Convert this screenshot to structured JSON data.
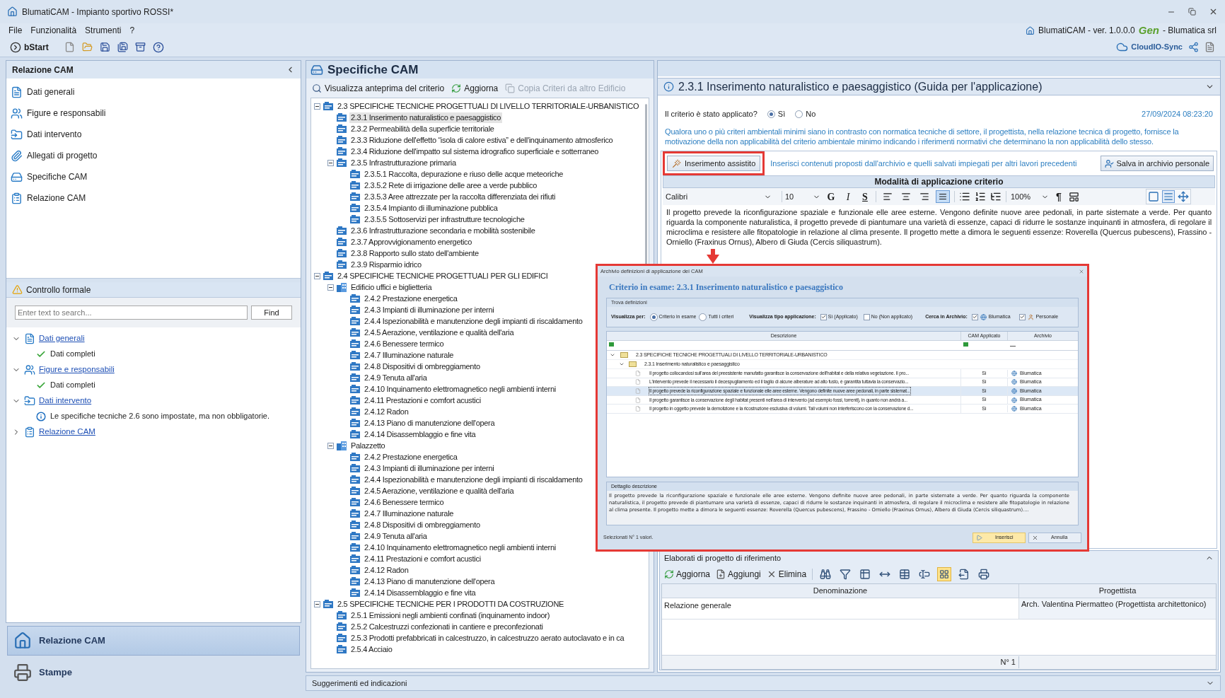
{
  "window": {
    "title": "BlumatiCAM - Impianto sportivo ROSSI*"
  },
  "menu": [
    "File",
    "Funzionalità",
    "Strumenti",
    "?"
  ],
  "product": {
    "version": "BlumatiCAM - ver. 1.0.0.0",
    "logo": "Gen",
    "company": "- Blumatica srl"
  },
  "toolbar": {
    "start": "bStart",
    "sync": "CloudIO-Sync"
  },
  "nav_panel": {
    "title": "Relazione CAM",
    "items": [
      "Dati generali",
      "Figure e responsabili",
      "Dati intervento",
      "Allegati di progetto",
      "Specifiche CAM",
      "Relazione CAM"
    ]
  },
  "formal_check": {
    "title": "Controllo formale",
    "search": {
      "placeholder": "Enter text to search..."
    },
    "find_button": "Find",
    "items": [
      {
        "label": "Dati generali",
        "expanded": true,
        "children": [
          {
            "label": "Dati completi",
            "kind": "ok"
          }
        ]
      },
      {
        "label": "Figure e responsabili",
        "expanded": true,
        "children": [
          {
            "label": "Dati completi",
            "kind": "ok"
          }
        ]
      },
      {
        "label": "Dati intervento",
        "expanded": true,
        "children": [
          {
            "label": "Le specifiche tecniche 2.6 sono impostate, ma non obbligatorie.",
            "kind": "info"
          }
        ]
      },
      {
        "label": "Relazione CAM",
        "expanded": false
      }
    ]
  },
  "nav_buttons": [
    {
      "label": "Relazione CAM",
      "selected": true
    },
    {
      "label": "Stampe",
      "selected": false
    }
  ],
  "specs_panel": {
    "title": "Specifiche CAM",
    "actions": [
      {
        "label": "Visualizza anteprima del criterio",
        "disabled": false
      },
      {
        "label": "Aggiorna",
        "disabled": false
      },
      {
        "label": "Copia Criteri da altro Edificio",
        "disabled": true
      }
    ],
    "tree": [
      {
        "label": "2.3 SPECIFICHE TECNICHE PROGETTUALI DI LIVELLO TERRITORIALE-URBANISTICO",
        "expanded": true,
        "selected": false,
        "children": [
          {
            "label": "2.3.1 Inserimento naturalistico e paesaggistico",
            "selected": true
          },
          {
            "label": "2.3.2 Permeabilità della superficie territoriale",
            "selected": false
          },
          {
            "label": "2.3.3 Riduzione dell'effetto “isola di calore estiva” e dell'inquinamento atmosferico",
            "selected": false
          },
          {
            "label": "2.3.4 Riduzione dell'impatto sul sistema idrografico superficiale e sotterraneo",
            "selected": false
          },
          {
            "label": "2.3.5 Infrastrutturazione primaria",
            "expanded": true,
            "selected": false,
            "children": [
              {
                "label": "2.3.5.1 Raccolta, depurazione e riuso delle acque meteoriche",
                "selected": false
              },
              {
                "label": "2.3.5.2 Rete di irrigazione delle aree a verde pubblico",
                "selected": false
              },
              {
                "label": "2.3.5.3 Aree attrezzate per la raccolta differenziata dei rifiuti",
                "selected": false
              },
              {
                "label": "2.3.5.4 Impianto di illuminazione pubblica",
                "selected": false
              },
              {
                "label": "2.3.5.5 Sottoservizi per infrastrutture tecnologiche",
                "selected": false
              }
            ]
          },
          {
            "label": "2.3.6 Infrastrutturazione secondaria e mobilità sostenibile",
            "selected": false
          },
          {
            "label": "2.3.7 Approvvigionamento energetico",
            "selected": false
          },
          {
            "label": "2.3.8 Rapporto sullo stato dell'ambiente",
            "selected": false
          },
          {
            "label": "2.3.9 Risparmio idrico",
            "selected": false
          }
        ]
      },
      {
        "label": "2.4 SPECIFICHE TECNICHE PROGETTUALI PER GLI EDIFICI",
        "expanded": true,
        "selected": false,
        "children": [
          {
            "label": "Edificio uffici e biglietteria",
            "kind": "building",
            "expanded": true,
            "selected": false,
            "children": [
              {
                "label": "2.4.2 Prestazione energetica",
                "selected": false
              },
              {
                "label": "2.4.3 Impianti di illuminazione per interni",
                "selected": false
              },
              {
                "label": "2.4.4 Ispezionabilità e manutenzione degli impianti di riscaldamento",
                "selected": false
              },
              {
                "label": "2.4.5 Aerazione, ventilazione e qualità dell'aria",
                "selected": false
              },
              {
                "label": "2.4.6 Benessere termico",
                "selected": false
              },
              {
                "label": "2.4.7 Illuminazione naturale",
                "selected": false
              },
              {
                "label": "2.4.8 Dispositivi di ombreggiamento",
                "selected": false
              },
              {
                "label": "2.4.9 Tenuta all'aria",
                "selected": false
              },
              {
                "label": "2.4.10 Inquinamento elettromagnetico negli ambienti interni",
                "selected": false
              },
              {
                "label": "2.4.11 Prestazioni e comfort acustici",
                "selected": false
              },
              {
                "label": "2.4.12 Radon",
                "selected": false
              },
              {
                "label": "2.4.13 Piano di manutenzione dell'opera",
                "selected": false
              },
              {
                "label": "2.4.14 Disassemblaggio e fine vita",
                "selected": false
              }
            ]
          },
          {
            "label": "Palazzetto",
            "kind": "building",
            "expanded": true,
            "selected": false,
            "children": [
              {
                "label": "2.4.2 Prestazione energetica",
                "selected": false
              },
              {
                "label": "2.4.3 Impianti di illuminazione per interni",
                "selected": false
              },
              {
                "label": "2.4.4 Ispezionabilità e manutenzione degli impianti di riscaldamento",
                "selected": false
              },
              {
                "label": "2.4.5 Aerazione, ventilazione e qualità dell'aria",
                "selected": false
              },
              {
                "label": "2.4.6 Benessere termico",
                "selected": false
              },
              {
                "label": "2.4.7 Illuminazione naturale",
                "selected": false
              },
              {
                "label": "2.4.8 Dispositivi di ombreggiamento",
                "selected": false
              },
              {
                "label": "2.4.9 Tenuta all'aria",
                "selected": false
              },
              {
                "label": "2.4.10 Inquinamento elettromagnetico negli ambienti interni",
                "selected": false
              },
              {
                "label": "2.4.11 Prestazioni e comfort acustici",
                "selected": false
              },
              {
                "label": "2.4.12 Radon",
                "selected": false
              },
              {
                "label": "2.4.13 Piano di manutenzione dell'opera",
                "selected": false
              },
              {
                "label": "2.4.14 Disassemblaggio e fine vita",
                "selected": false
              }
            ]
          }
        ]
      },
      {
        "label": "2.5 SPECIFICHE TECNICHE PER I PRODOTTI DA COSTRUZIONE",
        "expanded": true,
        "selected": false,
        "children": [
          {
            "label": "2.5.1 Emissioni negli ambienti confinati (inquinamento indoor)",
            "selected": false
          },
          {
            "label": "2.5.2 Calcestruzzi confezionati in cantiere e preconfezionati",
            "selected": false
          },
          {
            "label": "2.5.3 Prodotti prefabbricati in calcestruzzo, in calcestruzzo aerato autoclavato e in ca",
            "selected": false
          },
          {
            "label": "2.5.4 Acciaio",
            "selected": false
          }
        ]
      }
    ]
  },
  "criterion": {
    "title": "2.3.1 Inserimento naturalistico e paesaggistico (Guida per l'applicazione)",
    "question": "Il criterio è stato applicato?",
    "options": [
      {
        "label": "Sì",
        "selected": true
      },
      {
        "label": "No",
        "selected": false
      }
    ],
    "timestamp": "27/09/2024 08:23:20",
    "note": "Qualora uno o più criteri ambientali minimi siano in contrasto con normatica tecniche di settore, il progettista, nella relazione tecnica di progetto, fornisce la motivazione della non applicabilità del criterio ambientale minimo indicando i riferimenti normativi che determinano la non applicabilità dello stesso.",
    "assist_button": "Inserimento assistito",
    "assist_hint": "Inserisci contenuti proposti dall'archivio e quelli salvati impiegati per altri lavori precedenti",
    "save_button": "Salva in archivio personale",
    "editor": {
      "title": "Modalità di applicazione criterio",
      "font": "Calibri",
      "size": "10",
      "bold": "G",
      "italic": "I",
      "strike": "S",
      "zoom": "100%",
      "pilcrow": "¶",
      "align_buttons": [
        {
          "selected": false
        },
        {
          "selected": false
        },
        {
          "selected": false
        },
        {
          "selected": true
        }
      ],
      "float_tools": [
        {
          "selected": false
        },
        {
          "selected": true
        },
        {
          "selected": false
        }
      ],
      "text": "Il progetto prevede la riconfigurazione spaziale e funzionale elle aree esterne. Vengono definite nuove aree pedonali, in parte sistemate a verde. Per quanto riguarda la componente naturalistica, il progetto prevede di piantumare una varietà di essenze, capaci di ridurre le sostanze inquinanti in atmosfera, di regolare il microclima e resistere alle fitopatologie in relazione al clima presente. Il progetto mette a dimora le seguenti essenze: Roverella (Quercus pubescens), Frassino - Orniello (Fraxinus Ornus), Albero di Giuda (Cercis siliquastrum)."
    }
  },
  "archive_dialog": {
    "title": "Archivio definizioni di applicazione dei CAM",
    "heading": "Criterio in esame: 2.3.1 Inserimento naturalistico e paesaggistico",
    "filters_title": "Trova definizioni",
    "view_by": {
      "label": "Visualizza per:",
      "options": [
        {
          "label": "Criterio in esame",
          "selected": true
        },
        {
          "label": "Tutti i criteri",
          "selected": false
        }
      ]
    },
    "type_filter": {
      "label": "Visualizza tipo applicazione:",
      "options": [
        {
          "label": "Sì (Applicato)",
          "checked": true
        },
        {
          "label": "No (Non applicato)",
          "checked": false
        }
      ]
    },
    "archive_filter": {
      "label": "Cerca in Archivio:",
      "options": [
        {
          "label": "Blumatica",
          "checked": true
        },
        {
          "label": "Personale",
          "checked": true
        }
      ]
    },
    "columns": [
      "Descrizione",
      "CAM Applicato",
      "Archivio"
    ],
    "group": {
      "label": "2.3 SPECIFICHE TECNICHE PROGETTUALI DI LIVELLO TERRITORIALE-URBANISTICO",
      "expanded": true,
      "subgroup": {
        "label": "2.3.1 Inserimento naturalistico e paesaggistico",
        "expanded": true,
        "rows": [
          {
            "description": "Il progetto collocandosi sull'area del preesistente manufatto garantisce la conservazione dell'habitat e della relativa vegetazione. Il pro...",
            "applied": "Sì",
            "archive": "Blumatica",
            "selected": false
          },
          {
            "description": "L'intervento prevede il necessario il  decespugliamento ed il taglio di alcune alberature ad alto fusto, è garantita tuttavia la conservazio...",
            "applied": "Sì",
            "archive": "Blumatica",
            "selected": false
          },
          {
            "description": "Il progetto prevede la riconfigurazione spaziale e funzionale elle aree esterne. Vengono definite nuove aree pedonali, in parte sistemat...",
            "applied": "Sì",
            "archive": "Blumatica",
            "selected": true
          },
          {
            "description": "Il progetto garantisce la conservazione degli habitat presenti nell'area di intervento (ad esempio fossi, torrenti), in quanto non andrà a...",
            "applied": "Sì",
            "archive": "Blumatica",
            "selected": false
          },
          {
            "description": "Il progetto in oggetto prevede la demolizione e la ricostruzione esclusiva di volumi. Tali volumi non interferiscono con la conservazione d...",
            "applied": "Sì",
            "archive": "Blumatica",
            "selected": false
          }
        ]
      }
    },
    "detail": {
      "title": "Dettaglio descrizione",
      "text": "Il progetto prevede la riconfigurazione spaziale e funzionale elle aree esterne. Vengono definite nuove aree pedonali, in parte sistemate a verde. Per quanto riguarda la componente naturalistica, il progetto prevede di piantumare una varietà di essenze, capaci di ridurre le sostanze inquinanti in atmosfera, di regolare il microclima e resistere alle fitopatologie in relazione al clima presente. Il progetto mette a dimora le seguenti essenze: Roverella (Quercus pubescens), Frassino - Orniello (Fraxinus Ornus), Albero di Giuda (Cercis siliquastrum)...."
    },
    "status": "Selezionati N° 1 valori.",
    "buttons": [
      {
        "label": "Inserisci",
        "kind": "confirm"
      },
      {
        "label": "Annulla",
        "kind": "cancel"
      }
    ]
  },
  "references": {
    "title": "Elaborati di progetto di riferimento",
    "actions": [
      "Aggiorna",
      "Aggiungi",
      "Elimina"
    ],
    "tools": [
      {
        "on": false
      },
      {
        "on": false
      },
      {
        "on": false
      },
      {
        "on": false
      },
      {
        "on": false
      },
      {
        "on": false
      },
      {
        "on": true
      },
      {
        "on": false
      },
      {
        "on": false
      }
    ],
    "columns": [
      "Denominazione",
      "Progettista"
    ],
    "rows": [
      [
        "Relazione generale",
        "Arch. Valentina Piermatteo (Progettista architettonico)"
      ]
    ],
    "count": "N° 1"
  },
  "hints_bar": {
    "title": "Suggerimenti ed indicazioni"
  }
}
